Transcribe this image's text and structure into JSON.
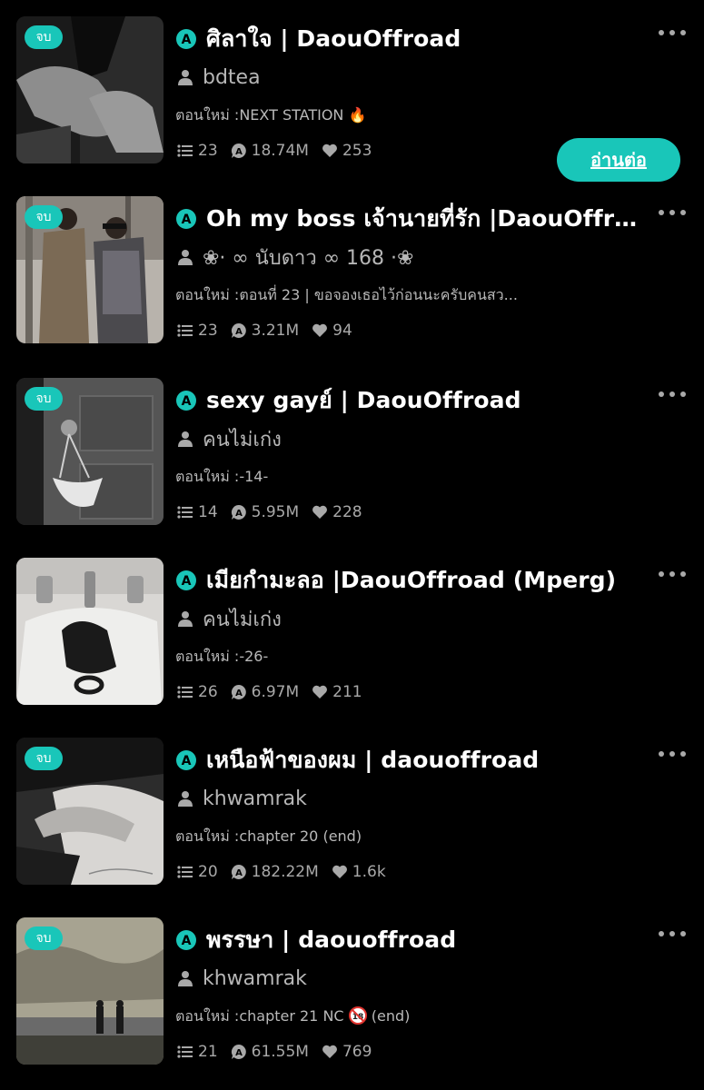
{
  "items": [
    {
      "badge": "จบ",
      "title": "ศิลาใจ | DaouOffroad",
      "author": "bdtea",
      "update": "ตอนใหม่ :NEXT STATION 🔥",
      "chapters": "23",
      "views": "18.74M",
      "likes": "253",
      "continue_label": "อ่านต่อ"
    },
    {
      "badge": "จบ",
      "title": "Oh my boss เจ้านายที่รัก |DaouOffroad",
      "author": "❀· ∞ นับดาว ∞ 168 ·❀",
      "update": "ตอนใหม่ :ตอนที่ 23 | ขอจองเธอไว้ก่อนนะครับคนสว...",
      "chapters": "23",
      "views": "3.21M",
      "likes": "94"
    },
    {
      "badge": "จบ",
      "title": "sexy gayย์ | DaouOffroad",
      "author": "คนไม่เก่ง",
      "update": "ตอนใหม่ :-14-",
      "chapters": "14",
      "views": "5.95M",
      "likes": "228"
    },
    {
      "badge": "จบ",
      "title": "เมียกำมะลอ |DaouOffroad (Mperg)",
      "author": "คนไม่เก่ง",
      "update": "ตอนใหม่ :-26-",
      "chapters": "26",
      "views": "6.97M",
      "likes": "211"
    },
    {
      "badge": "จบ",
      "title": "เหนือฟ้าของผม | daouoffroad",
      "author": "khwamrak",
      "update": "ตอนใหม่ :chapter 20 (end)",
      "chapters": "20",
      "views": "182.22M",
      "likes": "1.6k"
    },
    {
      "badge": "จบ",
      "title": "พรรษา | daouoffroad",
      "author": "khwamrak",
      "update_prefix": "ตอนใหม่ :chapter 21 NC",
      "update_suffix": "(end)",
      "chapters": "21",
      "views": "61.55M",
      "likes": "769"
    }
  ],
  "colors": {
    "accent": "#19c6b9",
    "background": "#000000",
    "muted": "#a9a9a9"
  },
  "icons": [
    "a-logo-icon",
    "person-icon",
    "list-icon",
    "views-icon",
    "heart-icon",
    "more-icon",
    "nc18-icon"
  ]
}
